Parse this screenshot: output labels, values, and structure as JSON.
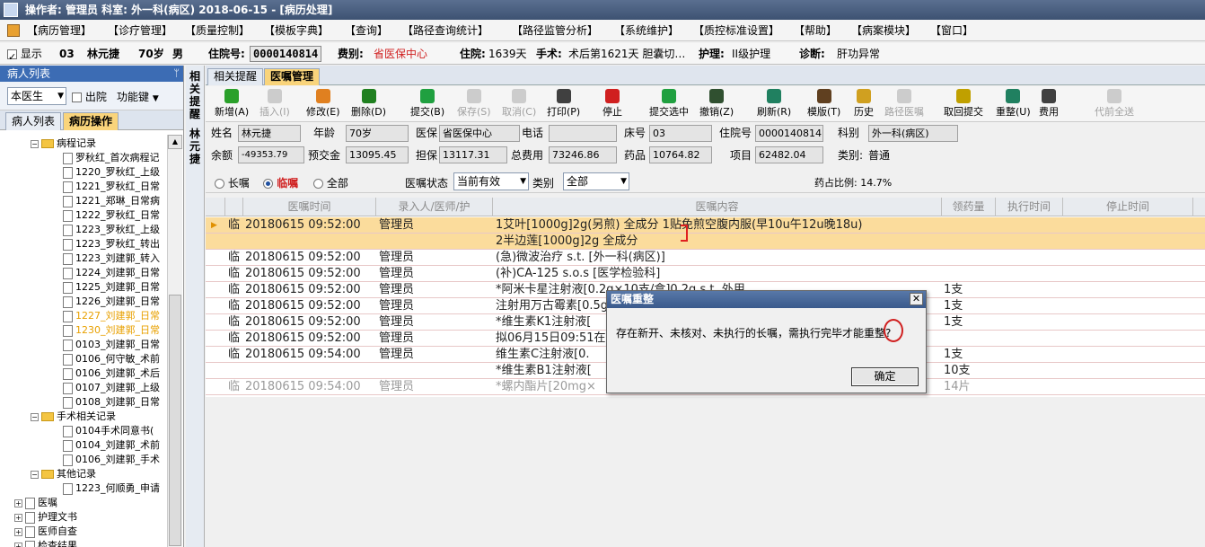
{
  "window": {
    "title": "操作者: 管理员  科室: 外一科(病区)  2018-06-15 - [病历处理]"
  },
  "menu": [
    "【病历管理】",
    "【诊疗管理】",
    "【质量控制】",
    "【模板字典】",
    "【查询】",
    "【路径查询统计】",
    "【路径监管分析】",
    "【系统维护】",
    "【质控标准设置】",
    "【帮助】",
    "【病案模块】",
    "【窗口】"
  ],
  "patient": {
    "show_label": "显示",
    "bed": "03",
    "name": "林元捷",
    "age": "70岁",
    "sex": "男",
    "inpatient_no_label": "住院号:",
    "inpatient_no": "0000140814",
    "fee_label": "费别:",
    "fee": "省医保中心",
    "stay_label": "住院:",
    "stay": "1639天",
    "surgery_label": "手术:",
    "surgery": "术后第1621天 胆囊切…",
    "nursing_label": "护理:",
    "nursing": "II级护理",
    "diag_label": "诊断:",
    "diag": "肝功异常"
  },
  "sidebar": {
    "title": "病人列表",
    "pin": "ᛘ",
    "doctor_select": "本医生",
    "discharge_label": "出院",
    "func_key": "功能键",
    "tab_list": "病人列表",
    "tab_ops": "病历操作",
    "tree": [
      {
        "t": "病程记录",
        "lvl": "folder"
      },
      {
        "t": "罗秋红_首次病程记",
        "lvl": "doc"
      },
      {
        "t": "1220_罗秋红_上级",
        "lvl": "doc"
      },
      {
        "t": "1221_罗秋红_日常",
        "lvl": "doc"
      },
      {
        "t": "1221_郑琳_日常病",
        "lvl": "doc"
      },
      {
        "t": "1222_罗秋红_日常",
        "lvl": "doc"
      },
      {
        "t": "1223_罗秋红_上级",
        "lvl": "doc"
      },
      {
        "t": "1223_罗秋红_转出",
        "lvl": "doc"
      },
      {
        "t": "1223_刘建郭_转入",
        "lvl": "doc"
      },
      {
        "t": "1224_刘建郭_日常",
        "lvl": "doc"
      },
      {
        "t": "1225_刘建郭_日常",
        "lvl": "doc"
      },
      {
        "t": "1226_刘建郭_日常",
        "lvl": "doc"
      },
      {
        "t": "1227_刘建郭_日常",
        "lvl": "doc-o"
      },
      {
        "t": "1230_刘建郭_日常",
        "lvl": "doc-o"
      },
      {
        "t": "0103_刘建郭_日常",
        "lvl": "doc"
      },
      {
        "t": "0106_何守敏_术前",
        "lvl": "doc"
      },
      {
        "t": "0106_刘建郭_术后",
        "lvl": "doc"
      },
      {
        "t": "0107_刘建郭_上级",
        "lvl": "doc"
      },
      {
        "t": "0108_刘建郭_日常",
        "lvl": "doc"
      },
      {
        "t": "手术相关记录",
        "lvl": "folder"
      },
      {
        "t": "0104手术同意书(",
        "lvl": "doc"
      },
      {
        "t": "0104_刘建郭_术前",
        "lvl": "doc"
      },
      {
        "t": "0106_刘建郭_手术",
        "lvl": "doc"
      },
      {
        "t": "其他记录",
        "lvl": "folder"
      },
      {
        "t": "1223_何顺勇_申请",
        "lvl": "doc"
      },
      {
        "t": "医嘱",
        "lvl": "root"
      },
      {
        "t": "护理文书",
        "lvl": "root"
      },
      {
        "t": "医师自查",
        "lvl": "root"
      },
      {
        "t": "检查结果",
        "lvl": "root"
      }
    ]
  },
  "vstrip": [
    "相",
    "关",
    "提",
    "醒",
    "林",
    "元",
    "捷"
  ],
  "tabs": [
    "相关提醒",
    "医嘱管理"
  ],
  "toolbar": [
    {
      "label": "新增(A)",
      "color": "#2aa02a",
      "dis": false
    },
    {
      "label": "插入(I)",
      "color": "#808080",
      "dis": true
    },
    {
      "label": "修改(E)",
      "color": "#e08020",
      "dis": false
    },
    {
      "label": "删除(D)",
      "color": "#208020",
      "dis": false
    },
    {
      "label": "提交(B)",
      "color": "#20a040",
      "dis": false
    },
    {
      "label": "保存(S)",
      "color": "#808080",
      "dis": true
    },
    {
      "label": "取消(C)",
      "color": "#808080",
      "dis": true
    },
    {
      "label": "打印(P)",
      "color": "#404040",
      "dis": false
    },
    {
      "label": "停止",
      "color": "#d02020",
      "dis": false
    },
    {
      "label": "提交选中",
      "color": "#20a040",
      "dis": false
    },
    {
      "label": "撤销(Z)",
      "color": "#305030",
      "dis": false
    },
    {
      "label": "刷新(R)",
      "color": "#208060",
      "dis": false
    },
    {
      "label": "模版(T)",
      "color": "#604020",
      "dis": false
    },
    {
      "label": "历史",
      "color": "#d0a020",
      "dis": false
    },
    {
      "label": "路径医嘱",
      "color": "#808080",
      "dis": true
    },
    {
      "label": "取回提交",
      "color": "#c0a000",
      "dis": false
    },
    {
      "label": "重整(U)",
      "color": "#208060",
      "dis": false
    },
    {
      "label": "费用",
      "color": "#404040",
      "dis": false
    },
    {
      "label": "代前全送",
      "color": "#808080",
      "dis": true
    }
  ],
  "info": {
    "name_l": "姓名",
    "name": "林元捷",
    "age_l": "年龄",
    "age": "70岁",
    "ins_l": "医保",
    "ins": "省医保中心",
    "phone_l": "电话",
    "phone": "",
    "bed_l": "床号",
    "bed": "03",
    "inno_l": "住院号",
    "inno": "0000140814",
    "dept_l": "科别",
    "dept": "外一科(病区)",
    "bal_l": "余额",
    "bal": "-49353.79",
    "pre_l": "预交金",
    "pre": "13095.45",
    "guar_l": "担保",
    "guar": "13117.31",
    "total_l": "总费用",
    "total": "73246.86",
    "drug_l": "药品",
    "drug": "10764.82",
    "item_l": "项目",
    "item": "62482.04",
    "cat_l": "类别:",
    "cat": "普通"
  },
  "filter": {
    "long": "长嘱",
    "temp": "临嘱",
    "all": "全部",
    "state_l": "医嘱状态",
    "state": "当前有效",
    "cat_l": "类别",
    "cat": "全部",
    "ratio": "药占比例: 14.7%"
  },
  "grid": {
    "headers": [
      "医嘱时间",
      "录入人/医师/护",
      "医嘱内容",
      "领药量",
      "执行时间",
      "停止时间"
    ],
    "rows": [
      {
        "f": "临",
        "time": "20180615 09:52:00",
        "who": "管理员",
        "content": "1艾叶[1000g]2g(另煎) 全成分 1贴免煎空腹内服(早10u午12u晚18u)",
        "qty": "",
        "sel": true
      },
      {
        "f": "",
        "time": "",
        "who": "",
        "content": "2半边莲[1000g]2g 全成分",
        "qty": "",
        "sel": true
      },
      {
        "f": "临",
        "time": "20180615 09:52:00",
        "who": "管理员",
        "content": "(急)微波治疗 s.t.  [外一科(病区)]",
        "qty": ""
      },
      {
        "f": "临",
        "time": "20180615 09:52:00",
        "who": "管理员",
        "content": "(补)CA-125 s.o.s  [医学检验科]",
        "qty": ""
      },
      {
        "f": "临",
        "time": "20180615 09:52:00",
        "who": "管理员",
        "content": "*阿米卡星注射液[0.2g×10支/盒]0.2g s.t. 外用",
        "qty": "1支"
      },
      {
        "f": "临",
        "time": "20180615 09:52:00",
        "who": "管理员",
        "content": "注射用万古霉素[0.5g",
        "qty": "1支"
      },
      {
        "f": "临",
        "time": "20180615 09:52:00",
        "who": "管理员",
        "content": "*维生素K1注射液[",
        "qty": "1支"
      },
      {
        "f": "临",
        "time": "20180615 09:52:00",
        "who": "管理员",
        "content": "拟06月15日09:51在",
        "qty": ""
      },
      {
        "f": "临",
        "time": "20180615 09:54:00",
        "who": "管理员",
        "content": "维生素C注射液[0.",
        "qty": "1支"
      },
      {
        "f": "",
        "time": "",
        "who": "",
        "content": "*维生素B1注射液[",
        "qty": "10支"
      },
      {
        "f": "临",
        "time": "20180615 09:54:00",
        "who": "管理员",
        "content": "*螺内酯片[20mg×",
        "qty": "14片",
        "gray": true
      }
    ]
  },
  "dialog": {
    "title": "医嘱重整",
    "close": "✕",
    "message": "存在新开、未核对、未执行的长嘱，需执行完毕才能重整?",
    "ok": "确定"
  }
}
